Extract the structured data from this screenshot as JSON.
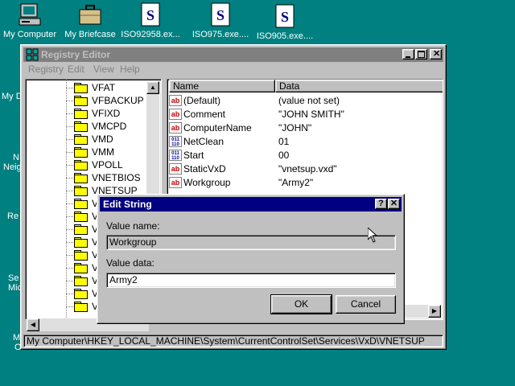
{
  "desktop": {
    "icons": [
      {
        "label": "My Computer",
        "icon": "computer-icon"
      },
      {
        "label": "My Briefcase",
        "icon": "briefcase-icon"
      },
      {
        "label": "ISO92958.ex...",
        "icon": "setup-exe-icon"
      },
      {
        "label": "ISO975.exe....",
        "icon": "setup-exe-icon"
      },
      {
        "label": "ISO905.exe....",
        "icon": "setup-exe-icon"
      }
    ],
    "partial_labels": [
      "My D",
      "N",
      "Neig",
      "Re",
      "Se",
      "Mic",
      "M",
      "O"
    ]
  },
  "regedit": {
    "title": "Registry Editor",
    "menu": [
      "Registry",
      "Edit",
      "View",
      "Help"
    ],
    "tree": {
      "items": [
        "VFAT",
        "VFBACKUP",
        "VFIXD",
        "VMCPD",
        "VMD",
        "VMM",
        "VPOLL",
        "VNETBIOS",
        "VNETSUP",
        "V",
        "V",
        "V",
        "V",
        "V",
        "V",
        "V",
        "V",
        "V"
      ],
      "selected_index": 8
    },
    "list": {
      "headers": {
        "name": "Name",
        "data": "Data"
      },
      "rows": [
        {
          "type": "string",
          "name": "(Default)",
          "data": "(value not set)"
        },
        {
          "type": "string",
          "name": "Comment",
          "data": "\"JOHN SMITH\""
        },
        {
          "type": "string",
          "name": "ComputerName",
          "data": "\"JOHN\""
        },
        {
          "type": "binary",
          "name": "NetClean",
          "data": "01"
        },
        {
          "type": "binary",
          "name": "Start",
          "data": "00"
        },
        {
          "type": "string",
          "name": "StaticVxD",
          "data": "\"vnetsup.vxd\""
        },
        {
          "type": "string",
          "name": "Workgroup",
          "data": "\"Army2\""
        }
      ]
    },
    "status": "My Computer\\HKEY_LOCAL_MACHINE\\System\\CurrentControlSet\\Services\\VxD\\VNETSUP"
  },
  "dialog": {
    "title": "Edit String",
    "help_button": "?",
    "close_button": "✕",
    "value_name_label": "Value name:",
    "value_name": "Workgroup",
    "value_data_label": "Value data:",
    "value_data": "Army2",
    "ok_label": "OK",
    "cancel_label": "Cancel"
  },
  "colors": {
    "desktop": "#008080",
    "active_title": "#000080",
    "inactive_title": "#808080",
    "face": "#c0c0c0"
  }
}
